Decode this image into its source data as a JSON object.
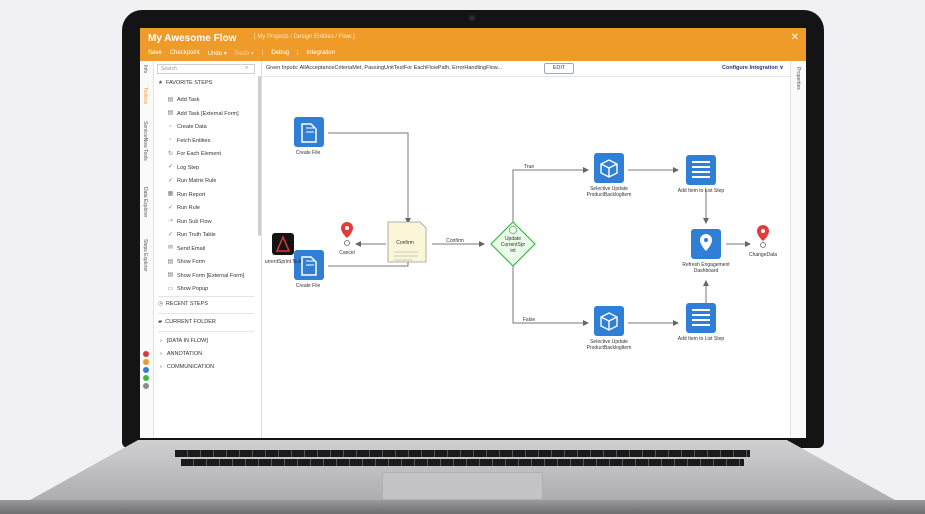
{
  "app": {
    "title": "My Awesome Flow",
    "breadcrumb": "[ My Projects / Design Entities / Flow ]",
    "menu": {
      "save": "Save",
      "checkpoint": "Checkpoint",
      "undo": "Undo",
      "redo": "Redo",
      "debug": "Debug",
      "integration": "Integration"
    },
    "close": "✕"
  },
  "left_tabs": [
    "Info",
    "Toolbox",
    "ServiceNow Tools",
    "Data Explorer",
    "Steps Explorer"
  ],
  "toolbox": {
    "search_placeholder": "Search",
    "favorite_header": "FAVORITE STEPS",
    "steps": [
      "Add Task",
      "Add Task [External Form]",
      "Create Data",
      "Fetch Entities",
      "For Each Element",
      "Log Step",
      "Run Matrix Rule",
      "Run Report",
      "Run Rule",
      "Run Sub Flow",
      "Run Truth Table",
      "Send Email",
      "Show Form",
      "Show Form [External Form]",
      "Show Popup"
    ],
    "recent_header": "RECENT STEPS",
    "current_header": "CURRENT FOLDER",
    "categories": [
      "[DATA IN FLOW]",
      "ANNOTATION",
      "COMMUNICATION"
    ]
  },
  "topbar": {
    "given_inputs": "Given Inputs: AllAcceptanceCriteriaMet, PassingUnitTestFor EachFlowPath, ErrorHandlingFlow...",
    "edit": "EDIT",
    "configure": "Configure Integration ∨"
  },
  "right_tab": "Properties",
  "flow": {
    "create_file_top": "Create File",
    "create_file_bottom": "Create File",
    "current_sprint": "urrentSprint Null",
    "cancel": "Cancel",
    "confirm_doc": "Confirm",
    "confirm_edge": "Confirm",
    "decision": [
      "Update",
      "CurrentSpr",
      "int"
    ],
    "true_label": "True",
    "false_label": "False",
    "update_top": [
      "Selective Update",
      "ProductBacklogItem"
    ],
    "update_bottom": [
      "Selective Update",
      "ProductBacklogItem"
    ],
    "add_list_top": "Add Item to List Step",
    "add_list_bottom": "Add Item to List Step",
    "refresh": [
      "Refresh Engagement",
      "Dashboard"
    ],
    "change_data": "ChangeData"
  },
  "colors": {
    "header": "#ef9b2a",
    "node_blue": "#2f7fd6",
    "decision_green": "#3eb849",
    "doc_yellow": "#fbf6d7",
    "end_red": "#e23b3b"
  }
}
